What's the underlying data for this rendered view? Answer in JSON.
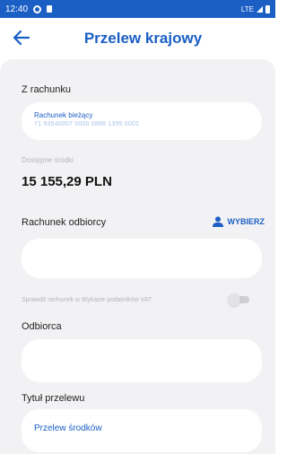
{
  "status_bar": {
    "time": "12:40",
    "network": "LTE",
    "icons": [
      "gear-icon",
      "doc-icon",
      "signal-icon",
      "battery-icon"
    ]
  },
  "header": {
    "title": "Przelew krajowy",
    "back_icon": "arrow-left-icon"
  },
  "from_account": {
    "label": "Z rachunku",
    "account_name": "Rachunek bieżący",
    "account_number": "71 93540007 0000 0898 1395 0001"
  },
  "available_funds": {
    "label": "Dostępne środki",
    "amount": "15 155,29 PLN"
  },
  "recipient_account": {
    "label": "Rachunek odbiorcy",
    "choose_label": "WYBIERZ",
    "choose_icon": "person-icon",
    "value": ""
  },
  "vat_check": {
    "label": "Sprawdź rachunek w Wykazie podatników VAT",
    "enabled": false
  },
  "recipient": {
    "label": "Odbiorca",
    "value": ""
  },
  "transfer_title": {
    "label": "Tytuł przelewu",
    "value": "Przelew środków"
  },
  "colors": {
    "accent": "#1b5fc4",
    "background": "#f2f2f4",
    "card": "#ffffff"
  }
}
